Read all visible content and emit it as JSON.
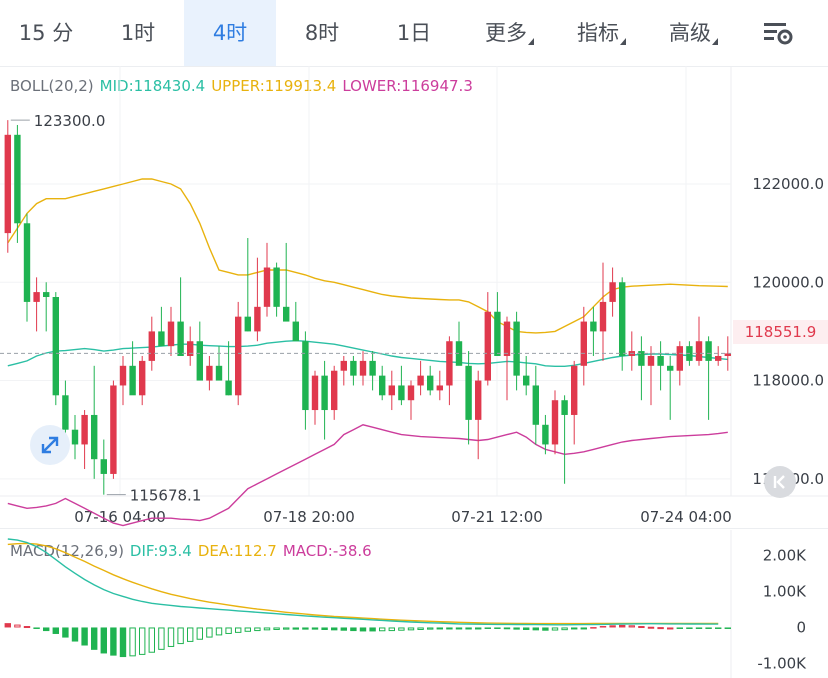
{
  "tabs": [
    {
      "label": "15 分",
      "active": false
    },
    {
      "label": "1时",
      "active": false
    },
    {
      "label": "4时",
      "active": true
    },
    {
      "label": "8时",
      "active": false
    },
    {
      "label": "1日",
      "active": false
    },
    {
      "label": "更多",
      "active": false,
      "dropdown": true
    },
    {
      "label": "指标",
      "active": false,
      "dropdown": true
    },
    {
      "label": "高级",
      "active": false,
      "dropdown": true
    }
  ],
  "settings_icon": "chart-settings-icon",
  "boll_legend": {
    "name": "BOLL(20,2)",
    "mid": "MID:118430.4",
    "upper": "UPPER:119913.4",
    "lower": "LOWER:116947.3"
  },
  "macd_legend": {
    "name": "MACD(12,26,9)",
    "dif": "DIF:93.4",
    "dea": "DEA:112.7",
    "macd": "MACD:-38.6"
  },
  "colors": {
    "up": "#e0394d",
    "down": "#1fb351",
    "mid": "#2bbfa4",
    "upper": "#e8b20e",
    "lower": "#cc3d9c",
    "accent": "#2f7de1"
  },
  "last_price_tag": "118551.9",
  "chart_data": [
    {
      "type": "candlestick",
      "y_ticks": [
        "122000.0",
        "120000.0",
        "118000.0",
        "116000.0"
      ],
      "x_ticks": [
        "07-16 04:00",
        "07-18 20:00",
        "07-21 12:00",
        "07-24 04:00"
      ],
      "ylim": [
        115000,
        124400
      ],
      "high_label": "123300.0",
      "low_label": "115678.1",
      "last_price": 118551.9,
      "candles": [
        [
          121000,
          123300,
          120600,
          123000
        ],
        [
          123000,
          123200,
          120800,
          121200
        ],
        [
          121200,
          121400,
          119200,
          119600
        ],
        [
          119600,
          120100,
          119000,
          119800
        ],
        [
          119800,
          120000,
          119000,
          119700
        ],
        [
          119700,
          119800,
          117500,
          117700
        ],
        [
          117700,
          118000,
          116600,
          117000
        ],
        [
          117000,
          117300,
          116400,
          116700
        ],
        [
          116700,
          117400,
          116200,
          117300
        ],
        [
          117300,
          118300,
          116000,
          116400
        ],
        [
          116400,
          116800,
          115678.1,
          116100
        ],
        [
          116100,
          118000,
          116000,
          117900
        ],
        [
          117900,
          118500,
          117500,
          118300
        ],
        [
          118300,
          118800,
          117900,
          117700
        ],
        [
          117700,
          118500,
          117500,
          118400
        ],
        [
          118400,
          119300,
          118200,
          119000
        ],
        [
          119000,
          119500,
          118700,
          118700
        ],
        [
          118700,
          119500,
          118500,
          119200
        ],
        [
          119200,
          120100,
          118600,
          118500
        ],
        [
          118500,
          119100,
          118300,
          118800
        ],
        [
          118800,
          119200,
          118300,
          118000
        ],
        [
          118000,
          118500,
          117800,
          118300
        ],
        [
          118300,
          118700,
          118000,
          118000
        ],
        [
          118000,
          118800,
          117700,
          117700
        ],
        [
          117700,
          119600,
          117500,
          119300
        ],
        [
          119300,
          120900,
          119000,
          119000
        ],
        [
          119000,
          120500,
          118800,
          119500
        ],
        [
          119500,
          120800,
          119300,
          120300
        ],
        [
          120300,
          120400,
          119300,
          119500
        ],
        [
          119500,
          120800,
          119400,
          119200
        ],
        [
          119200,
          119600,
          118900,
          118800
        ],
        [
          118800,
          119000,
          117000,
          117400
        ],
        [
          117400,
          118200,
          117100,
          118100
        ],
        [
          118100,
          118400,
          116800,
          117400
        ],
        [
          117400,
          118300,
          117200,
          118200
        ],
        [
          118200,
          118500,
          117900,
          118400
        ],
        [
          118400,
          118500,
          117900,
          118100
        ],
        [
          118100,
          118600,
          117900,
          118400
        ],
        [
          118400,
          118600,
          117800,
          118100
        ],
        [
          118100,
          118300,
          117600,
          117700
        ],
        [
          117700,
          118200,
          117400,
          117900
        ],
        [
          117900,
          118300,
          117500,
          117600
        ],
        [
          117600,
          118000,
          117200,
          117900
        ],
        [
          117900,
          118400,
          117700,
          118100
        ],
        [
          118100,
          118300,
          117700,
          117800
        ],
        [
          117800,
          118200,
          117600,
          117900
        ],
        [
          117900,
          118900,
          117500,
          118800
        ],
        [
          118800,
          119200,
          118500,
          118300
        ],
        [
          118300,
          118600,
          116700,
          117200
        ],
        [
          117200,
          118200,
          116400,
          118000
        ],
        [
          118000,
          119800,
          117900,
          119400
        ],
        [
          119400,
          119800,
          118500,
          118500
        ],
        [
          118500,
          119300,
          117600,
          119200
        ],
        [
          119200,
          119400,
          117800,
          118100
        ],
        [
          118100,
          118500,
          117700,
          117900
        ],
        [
          117900,
          118300,
          116700,
          117100
        ],
        [
          117100,
          117300,
          116500,
          116700
        ],
        [
          116700,
          117800,
          116500,
          117600
        ],
        [
          117600,
          117700,
          115900,
          117300
        ],
        [
          117300,
          118400,
          116700,
          118300
        ],
        [
          118300,
          119500,
          117900,
          119200
        ],
        [
          119200,
          119500,
          118500,
          119000
        ],
        [
          119000,
          120400,
          118400,
          119600
        ],
        [
          119600,
          120300,
          119300,
          120000
        ],
        [
          120000,
          120100,
          118200,
          118500
        ],
        [
          118500,
          119000,
          118200,
          118600
        ],
        [
          118600,
          118900,
          117600,
          118300
        ],
        [
          118300,
          118700,
          117500,
          118500
        ],
        [
          118500,
          118800,
          117800,
          118300
        ],
        [
          118300,
          118500,
          117200,
          118200
        ],
        [
          118200,
          118800,
          117900,
          118700
        ],
        [
          118700,
          118800,
          118300,
          118400
        ],
        [
          118400,
          119300,
          118300,
          118800
        ],
        [
          118800,
          118900,
          117200,
          118400
        ],
        [
          118400,
          118700,
          118300,
          118500
        ],
        [
          118500,
          118900,
          118200,
          118551.9
        ]
      ],
      "series": [
        {
          "name": "MID",
          "values": [
            118430.4
          ]
        },
        {
          "name": "UPPER",
          "values": [
            119913.4
          ]
        },
        {
          "name": "LOWER",
          "values": [
            116947.3
          ]
        }
      ],
      "mid": [
        118300,
        118350,
        118400,
        118500,
        118560,
        118600,
        118610,
        118630,
        118650,
        118630,
        118600,
        118620,
        118650,
        118660,
        118670,
        118680,
        118700,
        118720,
        118740,
        118740,
        118720,
        118710,
        118700,
        118690,
        118690,
        118700,
        118720,
        118760,
        118780,
        118800,
        118810,
        118800,
        118780,
        118760,
        118740,
        118700,
        118660,
        118620,
        118580,
        118540,
        118500,
        118470,
        118450,
        118430,
        118410,
        118390,
        118380,
        118370,
        118350,
        118340,
        118350,
        118370,
        118390,
        118380,
        118360,
        118340,
        118300,
        118290,
        118290,
        118310,
        118350,
        118390,
        118430,
        118470,
        118500,
        118520,
        118530,
        118540,
        118540,
        118530,
        118520,
        118510,
        118490,
        118470,
        118450,
        118430.4
      ],
      "upper": [
        120800,
        121100,
        121400,
        121600,
        121700,
        121700,
        121700,
        121750,
        121800,
        121850,
        121900,
        121950,
        122000,
        122050,
        122100,
        122100,
        122050,
        122000,
        121900,
        121600,
        121200,
        120700,
        120250,
        120200,
        120150,
        120150,
        120200,
        120250,
        120250,
        120250,
        120200,
        120150,
        120080,
        120030,
        120000,
        119950,
        119900,
        119850,
        119800,
        119750,
        119720,
        119700,
        119680,
        119670,
        119660,
        119650,
        119640,
        119640,
        119600,
        119500,
        119400,
        119200,
        119100,
        119000,
        118980,
        118970,
        118980,
        119000,
        119100,
        119200,
        119300,
        119500,
        119700,
        119850,
        119900,
        119920,
        119930,
        119940,
        119950,
        119960,
        119950,
        119940,
        119930,
        119925,
        119920,
        119913.4
      ],
      "lower": [
        115500,
        115450,
        115400,
        115420,
        115450,
        115500,
        115600,
        115500,
        115400,
        115300,
        115200,
        115100,
        115050,
        115100,
        115150,
        115200,
        115200,
        115200,
        115180,
        115170,
        115150,
        115200,
        115300,
        115400,
        115600,
        115800,
        115900,
        116000,
        116100,
        116200,
        116300,
        116400,
        116500,
        116600,
        116700,
        116900,
        117000,
        117100,
        117050,
        117000,
        116950,
        116900,
        116880,
        116860,
        116850,
        116840,
        116830,
        116820,
        116800,
        116780,
        116800,
        116850,
        116900,
        116950,
        116850,
        116700,
        116600,
        116550,
        116500,
        116520,
        116550,
        116600,
        116650,
        116700,
        116750,
        116780,
        116800,
        116820,
        116840,
        116860,
        116870,
        116880,
        116890,
        116900,
        116920,
        116947.3
      ]
    },
    {
      "type": "macd",
      "y_ticks": [
        "2.00K",
        "1.00K",
        "0",
        "-1.00K"
      ],
      "ylim": [
        -1400,
        2700
      ],
      "dif": [
        2450,
        2420,
        2350,
        2240,
        2080,
        1880,
        1680,
        1500,
        1330,
        1180,
        1050,
        940,
        860,
        780,
        720,
        670,
        640,
        610,
        580,
        560,
        540,
        520,
        500,
        480,
        460,
        440,
        420,
        400,
        380,
        360,
        340,
        320,
        300,
        285,
        270,
        255,
        240,
        225,
        210,
        195,
        180,
        165,
        150,
        140,
        130,
        120,
        110,
        100,
        95,
        90,
        88,
        86,
        84,
        82,
        80,
        78,
        76,
        75,
        75,
        76,
        78,
        80,
        85,
        90,
        95,
        100,
        102,
        103,
        102,
        100,
        98,
        96,
        95,
        94,
        93.4
      ],
      "dea": [
        2300,
        2320,
        2330,
        2310,
        2260,
        2180,
        2070,
        1950,
        1830,
        1700,
        1580,
        1460,
        1350,
        1250,
        1160,
        1070,
        990,
        920,
        860,
        800,
        750,
        700,
        660,
        620,
        580,
        545,
        510,
        480,
        450,
        420,
        395,
        370,
        345,
        325,
        305,
        290,
        275,
        260,
        245,
        230,
        215,
        200,
        190,
        180,
        170,
        160,
        150,
        142,
        135,
        128,
        122,
        118,
        115,
        112,
        110,
        108,
        107,
        106,
        106,
        107,
        108,
        109,
        110,
        111,
        112,
        113,
        113,
        113,
        113,
        113,
        113,
        113,
        113,
        112.9,
        112.7
      ],
      "hist": [
        120,
        80,
        40,
        -40,
        -100,
        -180,
        -280,
        -390,
        -500,
        -620,
        -720,
        -780,
        -820,
        -800,
        -760,
        -700,
        -620,
        -540,
        -460,
        -400,
        -340,
        -280,
        -220,
        -180,
        -150,
        -120,
        -100,
        -80,
        -70,
        -60,
        -60,
        -60,
        -60,
        -70,
        -80,
        -90,
        -100,
        -110,
        -110,
        -105,
        -100,
        -90,
        -80,
        -70,
        -60,
        -50,
        -40,
        -35,
        -30,
        -25,
        -30,
        -40,
        -50,
        -60,
        -70,
        -80,
        -90,
        -85,
        -75,
        -50,
        -20,
        10,
        40,
        60,
        70,
        60,
        40,
        20,
        10,
        0,
        -10,
        -15,
        -20,
        -25,
        -30,
        -38.6
      ]
    }
  ]
}
